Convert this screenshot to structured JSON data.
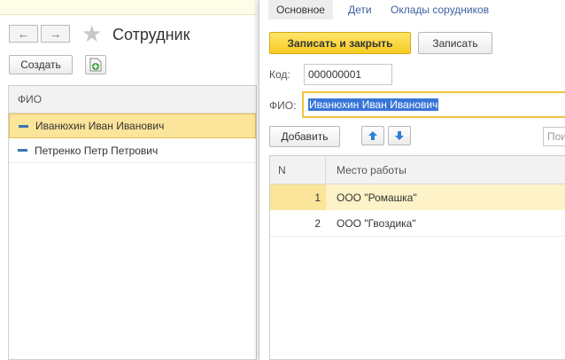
{
  "list_form": {
    "title": "Сотрудник",
    "create_button": "Создать",
    "column_fio": "ФИО",
    "rows": [
      {
        "name": "Иванюхин Иван Иванович",
        "selected": true
      },
      {
        "name": "Петренко Петр Петрович",
        "selected": false
      }
    ]
  },
  "detail_form": {
    "tabs": [
      "Основное",
      "Дети",
      "Оклады сорудников"
    ],
    "save_close_button": "Записать и закрыть",
    "save_button": "Записать",
    "code_label": "Код:",
    "code_value": "000000001",
    "fio_label": "ФИО:",
    "fio_value": "Иванюхин Иван Иванович",
    "add_button": "Добавить",
    "search_placeholder": "Пои",
    "table": {
      "col_n": "N",
      "col_workplace": "Место работы",
      "rows": [
        {
          "n": "1",
          "workplace": "ООО \"Ромашка\"",
          "selected": true
        },
        {
          "n": "2",
          "workplace": "ООО \"Гвоздика\"",
          "selected": false
        }
      ]
    }
  },
  "colors": {
    "accent_yellow": "#f6cc22",
    "selection": "#fbe59a",
    "text_selection": "#3875d7"
  },
  "icons": [
    "arrow-left-icon",
    "arrow-right-icon",
    "star-icon",
    "add-document-icon",
    "arrow-up-icon",
    "arrow-down-icon"
  ]
}
